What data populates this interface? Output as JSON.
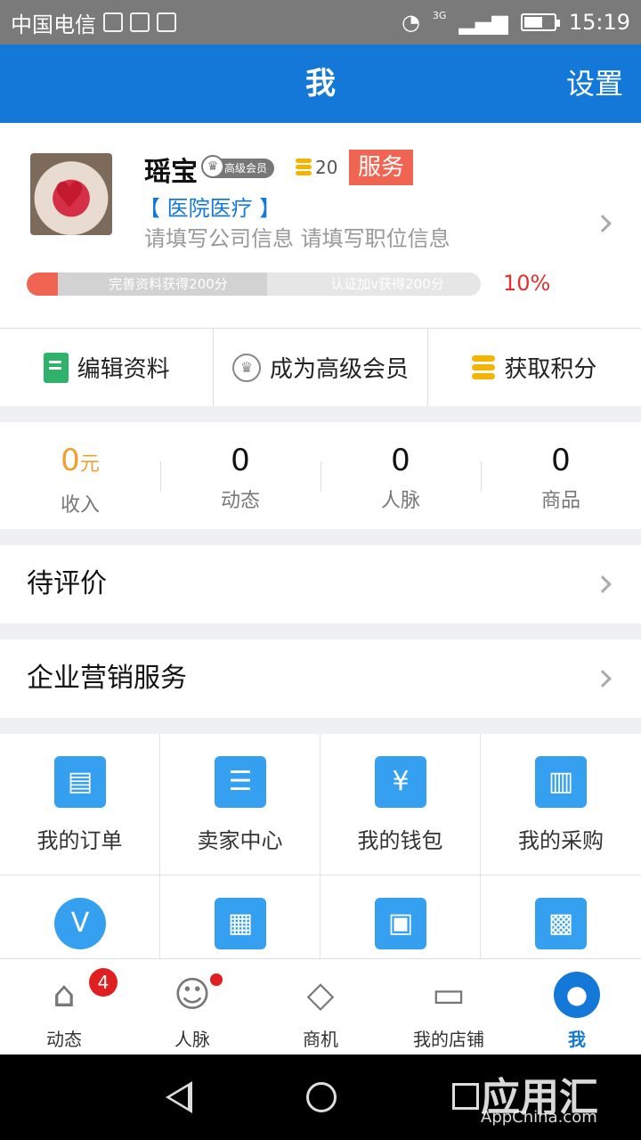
{
  "status_bar": {
    "carrier": "中国电信",
    "network": "3G",
    "time": "15:19"
  },
  "header": {
    "title": "我",
    "settings": "设置"
  },
  "profile": {
    "name": "瑶宝",
    "vip_label": "高级会员",
    "points": "20",
    "service_tag": "服务",
    "industry": "【 医院医疗 】",
    "company_prompt": "请填写公司信息 请填写职位信息",
    "progress_label_1": "完善资料获得200分",
    "progress_label_2": "认证加v获得200分",
    "progress_percent_text": "10%",
    "progress_fraction": 0.1
  },
  "actions": [
    {
      "label": "编辑资料",
      "icon": "edit-doc-icon"
    },
    {
      "label": "成为高级会员",
      "icon": "crown-icon"
    },
    {
      "label": "获取积分",
      "icon": "coins-icon"
    }
  ],
  "stats": [
    {
      "value": "0",
      "unit": "元",
      "label": "收入"
    },
    {
      "value": "0",
      "label": "动态"
    },
    {
      "value": "0",
      "label": "人脉"
    },
    {
      "value": "0",
      "label": "商品"
    }
  ],
  "rows": {
    "pending_review": "待评价",
    "marketing_service": "企业营销服务"
  },
  "grid": [
    {
      "label": "我的订单",
      "icon": "clipboard-icon"
    },
    {
      "label": "卖家中心",
      "icon": "seller-hand-icon"
    },
    {
      "label": "我的钱包",
      "icon": "money-bag-icon"
    },
    {
      "label": "我的采购",
      "icon": "basket-icon"
    },
    {
      "label": "",
      "icon": "v-badge-icon",
      "glyph": "V"
    },
    {
      "label": "",
      "icon": "news-icon"
    },
    {
      "label": "",
      "icon": "fax-icon"
    },
    {
      "label": "",
      "icon": "qr-code-icon"
    }
  ],
  "bottom_nav": [
    {
      "label": "动态",
      "icon": "home-icon",
      "badge": "4"
    },
    {
      "label": "人脉",
      "icon": "people-icon"
    },
    {
      "label": "商机",
      "icon": "handshake-icon"
    },
    {
      "label": "我的店铺",
      "icon": "shop-icon"
    },
    {
      "label": "我",
      "icon": "user-icon",
      "active": true
    }
  ],
  "watermark": {
    "text": "应用汇",
    "sub": "AppChina.com"
  },
  "colors": {
    "primary": "#1478d8",
    "accent_red": "#f06452",
    "orange": "#f0a030",
    "grid_icon": "#35a0f0"
  }
}
